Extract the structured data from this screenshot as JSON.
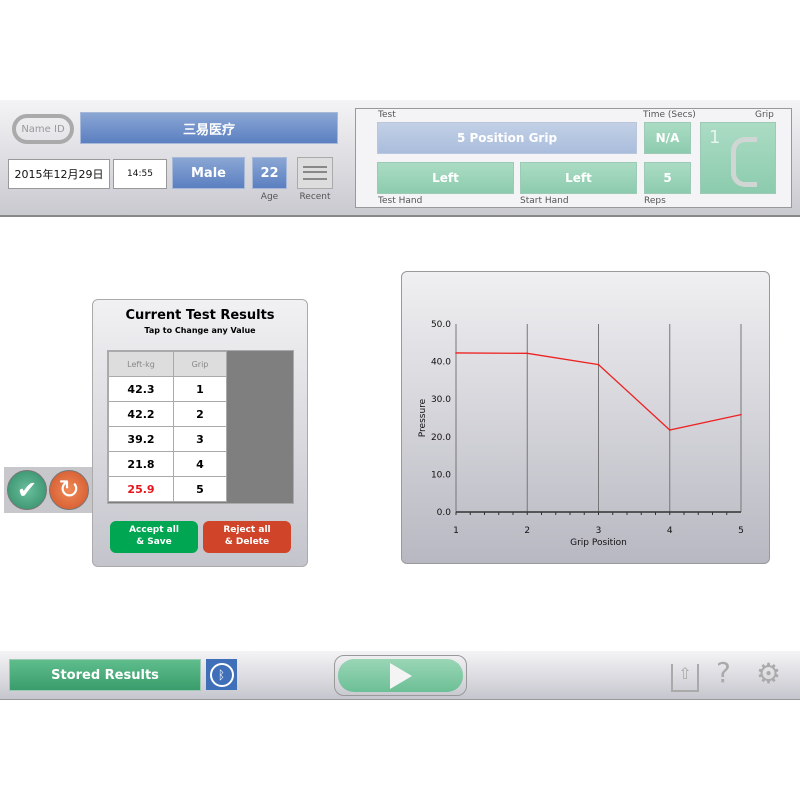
{
  "header": {
    "name_id_label": "Name ID",
    "name": "三易医疗",
    "date": "2015年12月29日",
    "time": "14:55",
    "gender": "Male",
    "age": "22",
    "age_label": "Age",
    "recent_label": "Recent"
  },
  "test": {
    "test_label": "Test",
    "test_value": "5 Position Grip",
    "time_label": "Time (Secs)",
    "time_value": "N/A",
    "grip_label": "Grip",
    "grip_number": "1",
    "test_hand_label": "Test Hand",
    "test_hand": "Left",
    "start_hand_label": "Start Hand",
    "start_hand": "Left",
    "reps_label": "Reps",
    "reps": "5"
  },
  "results": {
    "title": "Current Test Results",
    "subtitle": "Tap to Change any Value",
    "columns": [
      "Left-kg",
      "Grip"
    ],
    "rows": [
      {
        "value": "42.3",
        "grip": "1"
      },
      {
        "value": "42.2",
        "grip": "2"
      },
      {
        "value": "39.2",
        "grip": "3"
      },
      {
        "value": "21.8",
        "grip": "4"
      },
      {
        "value": "25.9",
        "grip": "5",
        "highlight": "#e8141b"
      }
    ],
    "accept_label": "Accept all\n& Save",
    "reject_label": "Reject all\n& Delete"
  },
  "chart_data": {
    "type": "line",
    "x": [
      1,
      2,
      3,
      4,
      5
    ],
    "series": [
      {
        "values": [
          42.3,
          42.2,
          39.2,
          21.8,
          25.9
        ],
        "color": "#ee2222"
      }
    ],
    "xlabel": "Grip Position",
    "ylabel": "Pressure",
    "ylim": [
      0,
      50
    ],
    "yticks": [
      "0.0",
      "10.0",
      "20.0",
      "30.0",
      "40.0",
      "50.0"
    ],
    "xticks": [
      "1",
      "2",
      "3",
      "4",
      "5"
    ],
    "grid": "vertical"
  },
  "footer": {
    "stored_results": "Stored Results"
  },
  "colors": {
    "accent_blue": "#5b7fc0",
    "accent_green": "#8ccbae",
    "accept": "#00a651",
    "reject": "#d0442a"
  }
}
